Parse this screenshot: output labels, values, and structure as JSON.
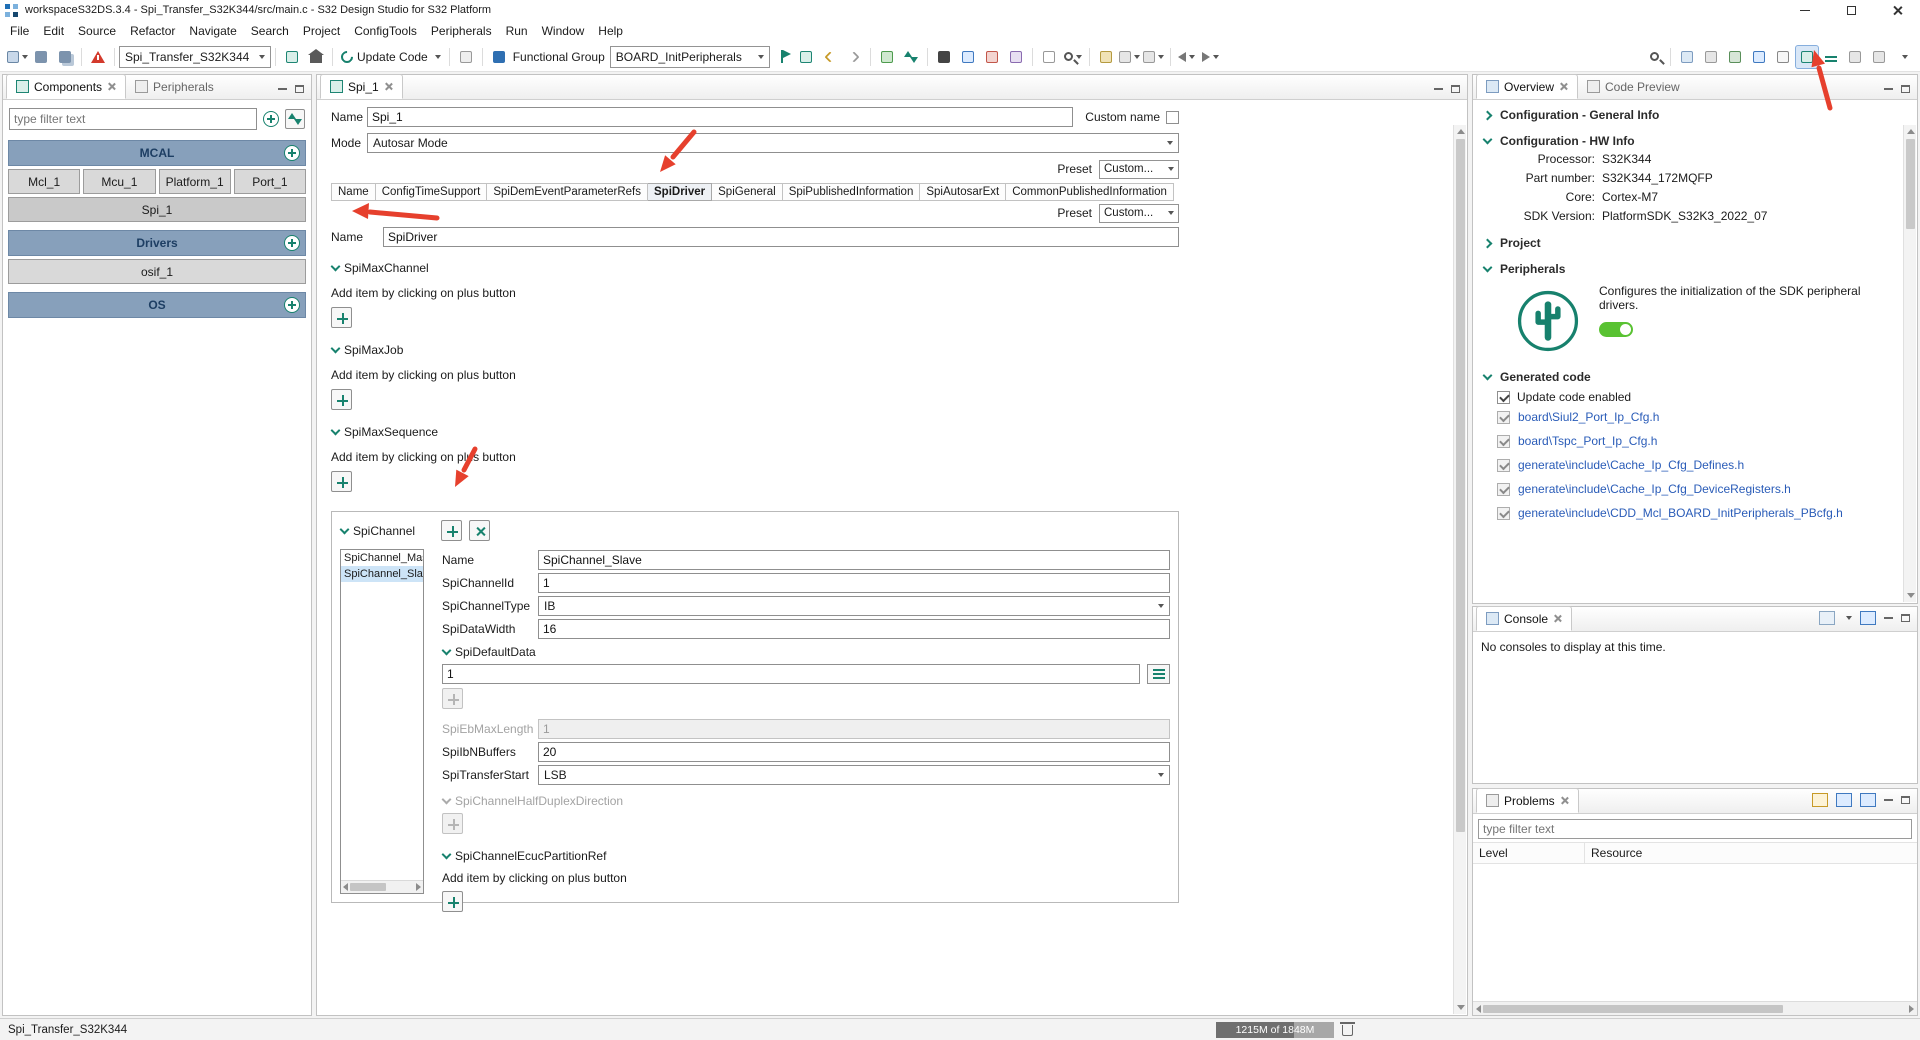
{
  "window": {
    "title": "workspaceS32DS.3.4 - Spi_Transfer_S32K344/src/main.c - S32 Design Studio for S32 Platform"
  },
  "menubar": {
    "items": [
      "File",
      "Edit",
      "Source",
      "Refactor",
      "Navigate",
      "Search",
      "Project",
      "ConfigTools",
      "Peripherals",
      "Run",
      "Window",
      "Help"
    ]
  },
  "toolbar": {
    "project_combo": "Spi_Transfer_S32K344",
    "update_code": "Update Code",
    "functional_group_label": "Functional Group",
    "functional_group_combo": "BOARD_InitPeripherals"
  },
  "components": {
    "tabs": {
      "components": "Components",
      "peripherals": "Peripherals"
    },
    "filter_placeholder": "type filter text",
    "mcal": {
      "title": "MCAL",
      "row_items": [
        "Mcl_1",
        "Mcu_1",
        "Platform_1",
        "Port_1"
      ],
      "full_item": "Spi_1"
    },
    "drivers": {
      "title": "Drivers",
      "full_item": "osif_1"
    },
    "os": {
      "title": "OS"
    }
  },
  "editor": {
    "tab": "Spi_1",
    "name_label": "Name",
    "name_value": "Spi_1",
    "custom_name": "Custom name",
    "mode_label": "Mode",
    "mode_value": "Autosar Mode",
    "preset_label": "Preset",
    "preset_value": "Custom...",
    "tabs": [
      "Name",
      "ConfigTimeSupport",
      "SpiDemEventParameterRefs",
      "SpiDriver",
      "SpiGeneral",
      "SpiPublishedInformation",
      "SpiAutosarExt",
      "CommonPublishedInformation"
    ],
    "driver_name_label": "Name",
    "driver_name_value": "SpiDriver",
    "add_hint": "Add item by clicking on plus button",
    "sec_max_channel": "SpiMaxChannel",
    "sec_max_job": "SpiMaxJob",
    "sec_max_sequence": "SpiMaxSequence",
    "sec_channel": "SpiChannel",
    "channel_list": [
      "SpiChannel_Mast",
      "SpiChannel_Slave"
    ],
    "form": {
      "name_label": "Name",
      "name_value": "SpiChannel_Slave",
      "id_label": "SpiChannelId",
      "id_value": "1",
      "type_label": "SpiChannelType",
      "type_value": "IB",
      "width_label": "SpiDataWidth",
      "width_value": "16",
      "default_data_label": "SpiDefaultData",
      "default_data_value": "1",
      "eb_label": "SpiEbMaxLength",
      "eb_value": "1",
      "ib_label": "SpiIbNBuffers",
      "ib_value": "20",
      "transfer_label": "SpiTransferStart",
      "transfer_value": "LSB",
      "half_duplex_label": "SpiChannelHalfDuplexDirection",
      "ecuc_label": "SpiChannelEcucPartitionRef"
    }
  },
  "overview": {
    "tabs": {
      "overview": "Overview",
      "code_preview": "Code Preview"
    },
    "sections": {
      "general": "Configuration - General Info",
      "hw": "Configuration - HW Info",
      "project": "Project",
      "peripherals": "Peripherals",
      "generated": "Generated code"
    },
    "hw_rows": [
      {
        "k": "Processor:",
        "v": "S32K344"
      },
      {
        "k": "Part number:",
        "v": "S32K344_172MQFP"
      },
      {
        "k": "Core:",
        "v": "Cortex-M7"
      },
      {
        "k": "SDK Version:",
        "v": "PlatformSDK_S32K3_2022_07"
      }
    ],
    "peripherals_desc": "Configures the initialization of the SDK peripheral drivers.",
    "update_checkbox": "Update code enabled",
    "files": [
      "board\\Siul2_Port_Ip_Cfg.h",
      "board\\Tspc_Port_Ip_Cfg.h",
      "generate\\include\\Cache_Ip_Cfg_Defines.h",
      "generate\\include\\Cache_Ip_Cfg_DeviceRegisters.h",
      "generate\\include\\CDD_Mcl_BOARD_InitPeripherals_PBcfg.h"
    ]
  },
  "console": {
    "tab": "Console",
    "message": "No consoles to display at this time."
  },
  "problems": {
    "tab": "Problems",
    "filter_placeholder": "type filter text",
    "col_level": "Level",
    "col_resource": "Resource"
  },
  "statusbar": {
    "project": "Spi_Transfer_S32K344",
    "memory": "1215M of 1848M"
  },
  "colors": {
    "accent_teal": "#18826e",
    "header_blue": "#87a0bb",
    "arrow_red": "#e6402d",
    "link_blue": "#2a5cb8",
    "toggle_green": "#59c232",
    "selection_blue": "#cde4f7"
  }
}
